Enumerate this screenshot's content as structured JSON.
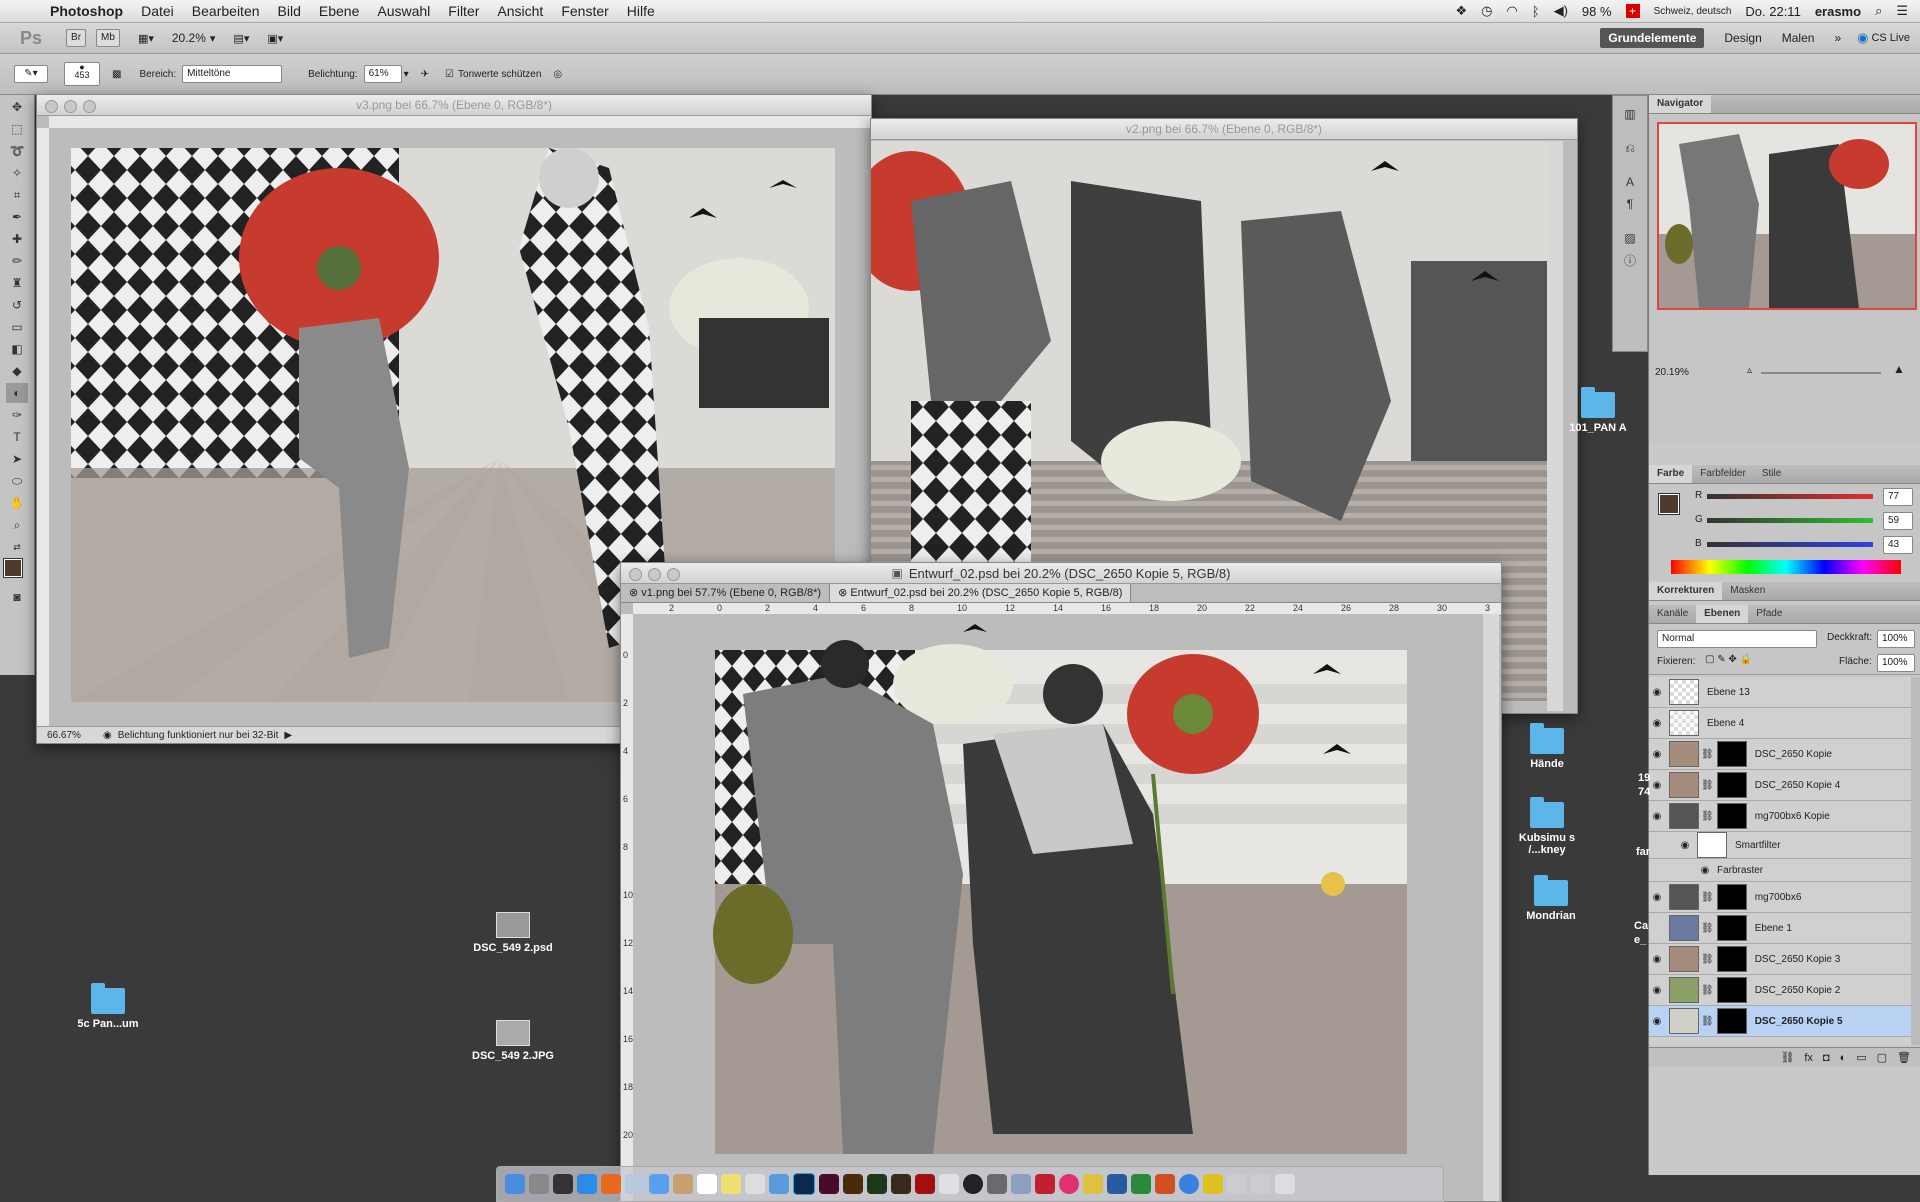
{
  "menubar": {
    "app": "Photoshop",
    "items": [
      "Datei",
      "Bearbeiten",
      "Bild",
      "Ebene",
      "Auswahl",
      "Filter",
      "Ansicht",
      "Fenster",
      "Hilfe"
    ],
    "battery": "98 %",
    "keyboard": "Schweiz, deutsch",
    "clock": "Do. 22:11",
    "user": "erasmo"
  },
  "appbar": {
    "ps": "Ps",
    "br": "Br",
    "mb": "Mb",
    "zoom": "20.2%",
    "workspaces": [
      "Grundelemente",
      "Design",
      "Malen"
    ],
    "more": "»",
    "cslive": "CS Live"
  },
  "options": {
    "brush_size": "453",
    "bereich_label": "Bereich:",
    "bereich_value": "Mitteltöne",
    "belichtung_label": "Belichtung:",
    "belichtung_value": "61%",
    "tonwerte_label": "Tonwerte schützen"
  },
  "windows": {
    "v3": {
      "title": "v3.png bei 66.7% (Ebene 0, RGB/8*)",
      "zoom": "66.67%",
      "status": "Belichtung funktioniert nur bei 32-Bit"
    },
    "v2": {
      "title": "v2.png bei 66.7% (Ebene 0, RGB/8*)"
    },
    "entwurf": {
      "title": "Entwurf_02.psd bei 20.2% (DSC_2650 Kopie 5, RGB/8)",
      "tabs": [
        "v1.png bei 57.7% (Ebene 0, RGB/8*)",
        "Entwurf_02.psd bei 20.2% (DSC_2650 Kopie 5, RGB/8)"
      ],
      "ruler": [
        "2",
        "0",
        "2",
        "4",
        "6",
        "8",
        "10",
        "12",
        "14",
        "16",
        "18",
        "20",
        "22",
        "24",
        "26",
        "28",
        "30",
        "3"
      ],
      "vruler": [
        "0",
        "2",
        "4",
        "6",
        "8",
        "10",
        "12",
        "14",
        "16",
        "18",
        "20"
      ]
    }
  },
  "panels": {
    "navigator": {
      "tab": "Navigator",
      "zoom": "20.19%"
    },
    "color": {
      "tabs": [
        "Farbe",
        "Farbfelder",
        "Stile"
      ],
      "r_label": "R",
      "g_label": "G",
      "b_label": "B",
      "r": "77",
      "g": "59",
      "b": "43",
      "fg": "#4d3b2b"
    },
    "adjust": {
      "tabs": [
        "Korrekturen",
        "Masken"
      ]
    },
    "layers": {
      "tabs": [
        "Kanäle",
        "Ebenen",
        "Pfade"
      ],
      "blend": "Normal",
      "opacity_label": "Deckkraft:",
      "opacity": "100%",
      "fix_label": "Fixieren:",
      "fill_label": "Fläche:",
      "fill": "100%",
      "items": [
        {
          "name": "Ebene 13"
        },
        {
          "name": "Ebene 4"
        },
        {
          "name": "DSC_2650 Kopie"
        },
        {
          "name": "DSC_2650 Kopie 4"
        },
        {
          "name": "mg700bx6 Kopie"
        },
        {
          "name": "Smartfilter"
        },
        {
          "name": "Farbraster"
        },
        {
          "name": "mg700bx6"
        },
        {
          "name": "Ebene 1"
        },
        {
          "name": "DSC_2650 Kopie 3"
        },
        {
          "name": "DSC_2650 Kopie 2"
        },
        {
          "name": "DSC_2650 Kopie 5"
        }
      ]
    }
  },
  "desktop": {
    "icons": [
      {
        "label": "101_PAN A"
      },
      {
        "label": "Hände"
      },
      {
        "label": "Kubsimu s /...kney"
      },
      {
        "label": "Mondrian"
      },
      {
        "label": "DSC_549 2.psd"
      },
      {
        "label": "DSC_549 2.JPG"
      },
      {
        "label": "5c Pan...um"
      }
    ],
    "cut_labels": [
      "19",
      "74",
      "far",
      "Ca",
      "e_"
    ]
  }
}
